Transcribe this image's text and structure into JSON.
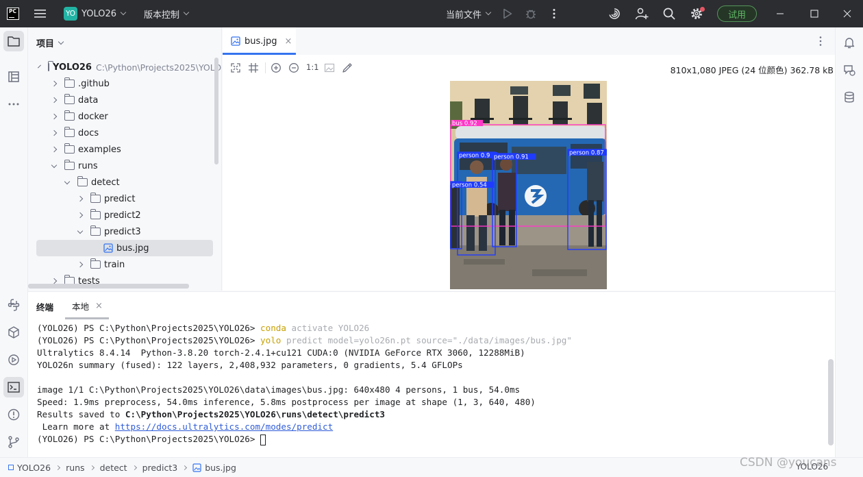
{
  "titlebar": {
    "logo": "PC",
    "project_badge": "YO",
    "project_name": "YOLO26",
    "vcs_label": "版本控制",
    "run_config": "当前文件",
    "trial_label": "试用"
  },
  "project_panel": {
    "title": "项目",
    "root": {
      "name": "YOLO26",
      "path": "C:\\Python\\Projects2025\\YOLO26"
    },
    "items": [
      {
        "label": ".github",
        "depth": 1,
        "kind": "folder",
        "expanded": false
      },
      {
        "label": "data",
        "depth": 1,
        "kind": "folder",
        "expanded": false
      },
      {
        "label": "docker",
        "depth": 1,
        "kind": "folder",
        "expanded": false
      },
      {
        "label": "docs",
        "depth": 1,
        "kind": "folder",
        "expanded": false
      },
      {
        "label": "examples",
        "depth": 1,
        "kind": "folder",
        "expanded": false
      },
      {
        "label": "runs",
        "depth": 1,
        "kind": "folder",
        "expanded": true
      },
      {
        "label": "detect",
        "depth": 2,
        "kind": "folder",
        "expanded": true
      },
      {
        "label": "predict",
        "depth": 3,
        "kind": "folder",
        "expanded": false
      },
      {
        "label": "predict2",
        "depth": 3,
        "kind": "folder",
        "expanded": false
      },
      {
        "label": "predict3",
        "depth": 3,
        "kind": "folder",
        "expanded": true
      },
      {
        "label": "bus.jpg",
        "depth": 4,
        "kind": "image",
        "selected": true
      },
      {
        "label": "train",
        "depth": 3,
        "kind": "folder",
        "expanded": false
      },
      {
        "label": "tests",
        "depth": 1,
        "kind": "folder",
        "expanded": false
      }
    ]
  },
  "editor": {
    "tab_label": "bus.jpg",
    "zoom_label": "1:1",
    "image_info": "810x1,080 JPEG (24 位颜色) 362.78 kB",
    "detections": [
      {
        "label": "bus 0.92",
        "color": "#ff37c7"
      },
      {
        "label": "person 0.9",
        "color": "#1f3bff"
      },
      {
        "label": "person 0.91",
        "color": "#1f3bff"
      },
      {
        "label": "person 0.87",
        "color": "#1f3bff"
      },
      {
        "label": "person 0.54",
        "color": "#1f3bff"
      }
    ]
  },
  "terminal": {
    "tabs": [
      {
        "label": "终端"
      },
      {
        "label": "本地"
      }
    ],
    "lines": [
      {
        "prompt": "(YOLO26) PS C:\\Python\\Projects2025\\YOLO26> ",
        "cmd": "conda",
        "rest": " activate YOLO26"
      },
      {
        "prompt": "(YOLO26) PS C:\\Python\\Projects2025\\YOLO26> ",
        "cmd": "yolo",
        "rest": " predict model=yolo26n.pt source=\"./data/images/bus.jpg\""
      },
      {
        "text": "Ultralytics 8.4.14  Python-3.8.20 torch-2.4.1+cu121 CUDA:0 (NVIDIA GeForce RTX 3060, 12288MiB)"
      },
      {
        "text": "YOLO26n summary (fused): 122 layers, 2,408,932 parameters, 0 gradients, 5.4 GFLOPs"
      },
      {
        "text": ""
      },
      {
        "text": "image 1/1 C:\\Python\\Projects2025\\YOLO26\\data\\images\\bus.jpg: 640x480 4 persons, 1 bus, 54.0ms"
      },
      {
        "text": "Speed: 1.9ms preprocess, 54.0ms inference, 5.8ms postprocess per image at shape (1, 3, 640, 480)"
      },
      {
        "prefix": "Results saved to ",
        "bold": "C:\\Python\\Projects2025\\YOLO26\\runs\\detect\\predict3"
      },
      {
        "prefix": " Learn more at ",
        "link": "https://docs.ultralytics.com/modes/predict"
      },
      {
        "prompt_only": "(YOLO26) PS C:\\Python\\Projects2025\\YOLO26> "
      }
    ]
  },
  "statusbar": {
    "breadcrumb": [
      "YOLO26",
      "runs",
      "detect",
      "predict3",
      "bus.jpg"
    ],
    "right_label": "YOLO26",
    "watermark": "CSDN @youcans"
  }
}
